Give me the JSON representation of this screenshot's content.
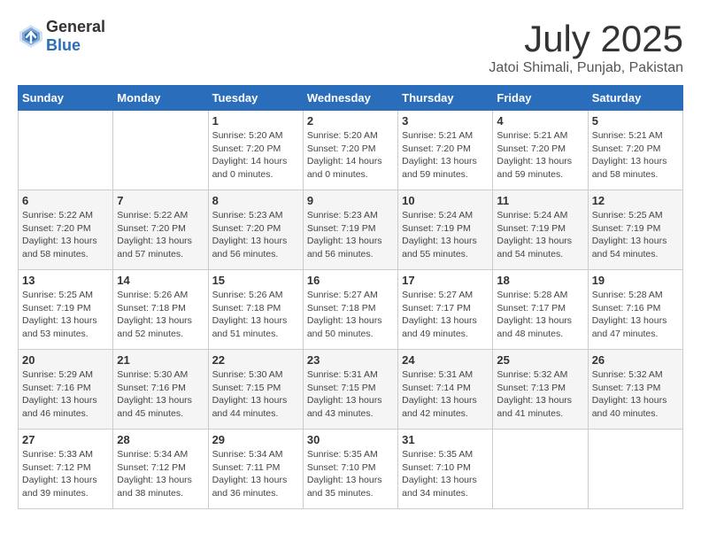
{
  "header": {
    "logo_general": "General",
    "logo_blue": "Blue",
    "title": "July 2025",
    "location": "Jatoi Shimali, Punjab, Pakistan"
  },
  "calendar": {
    "weekdays": [
      "Sunday",
      "Monday",
      "Tuesday",
      "Wednesday",
      "Thursday",
      "Friday",
      "Saturday"
    ],
    "weeks": [
      [
        {
          "day": "",
          "info": ""
        },
        {
          "day": "",
          "info": ""
        },
        {
          "day": "1",
          "info": "Sunrise: 5:20 AM\nSunset: 7:20 PM\nDaylight: 14 hours\nand 0 minutes."
        },
        {
          "day": "2",
          "info": "Sunrise: 5:20 AM\nSunset: 7:20 PM\nDaylight: 14 hours\nand 0 minutes."
        },
        {
          "day": "3",
          "info": "Sunrise: 5:21 AM\nSunset: 7:20 PM\nDaylight: 13 hours\nand 59 minutes."
        },
        {
          "day": "4",
          "info": "Sunrise: 5:21 AM\nSunset: 7:20 PM\nDaylight: 13 hours\nand 59 minutes."
        },
        {
          "day": "5",
          "info": "Sunrise: 5:21 AM\nSunset: 7:20 PM\nDaylight: 13 hours\nand 58 minutes."
        }
      ],
      [
        {
          "day": "6",
          "info": "Sunrise: 5:22 AM\nSunset: 7:20 PM\nDaylight: 13 hours\nand 58 minutes."
        },
        {
          "day": "7",
          "info": "Sunrise: 5:22 AM\nSunset: 7:20 PM\nDaylight: 13 hours\nand 57 minutes."
        },
        {
          "day": "8",
          "info": "Sunrise: 5:23 AM\nSunset: 7:20 PM\nDaylight: 13 hours\nand 56 minutes."
        },
        {
          "day": "9",
          "info": "Sunrise: 5:23 AM\nSunset: 7:19 PM\nDaylight: 13 hours\nand 56 minutes."
        },
        {
          "day": "10",
          "info": "Sunrise: 5:24 AM\nSunset: 7:19 PM\nDaylight: 13 hours\nand 55 minutes."
        },
        {
          "day": "11",
          "info": "Sunrise: 5:24 AM\nSunset: 7:19 PM\nDaylight: 13 hours\nand 54 minutes."
        },
        {
          "day": "12",
          "info": "Sunrise: 5:25 AM\nSunset: 7:19 PM\nDaylight: 13 hours\nand 54 minutes."
        }
      ],
      [
        {
          "day": "13",
          "info": "Sunrise: 5:25 AM\nSunset: 7:19 PM\nDaylight: 13 hours\nand 53 minutes."
        },
        {
          "day": "14",
          "info": "Sunrise: 5:26 AM\nSunset: 7:18 PM\nDaylight: 13 hours\nand 52 minutes."
        },
        {
          "day": "15",
          "info": "Sunrise: 5:26 AM\nSunset: 7:18 PM\nDaylight: 13 hours\nand 51 minutes."
        },
        {
          "day": "16",
          "info": "Sunrise: 5:27 AM\nSunset: 7:18 PM\nDaylight: 13 hours\nand 50 minutes."
        },
        {
          "day": "17",
          "info": "Sunrise: 5:27 AM\nSunset: 7:17 PM\nDaylight: 13 hours\nand 49 minutes."
        },
        {
          "day": "18",
          "info": "Sunrise: 5:28 AM\nSunset: 7:17 PM\nDaylight: 13 hours\nand 48 minutes."
        },
        {
          "day": "19",
          "info": "Sunrise: 5:28 AM\nSunset: 7:16 PM\nDaylight: 13 hours\nand 47 minutes."
        }
      ],
      [
        {
          "day": "20",
          "info": "Sunrise: 5:29 AM\nSunset: 7:16 PM\nDaylight: 13 hours\nand 46 minutes."
        },
        {
          "day": "21",
          "info": "Sunrise: 5:30 AM\nSunset: 7:16 PM\nDaylight: 13 hours\nand 45 minutes."
        },
        {
          "day": "22",
          "info": "Sunrise: 5:30 AM\nSunset: 7:15 PM\nDaylight: 13 hours\nand 44 minutes."
        },
        {
          "day": "23",
          "info": "Sunrise: 5:31 AM\nSunset: 7:15 PM\nDaylight: 13 hours\nand 43 minutes."
        },
        {
          "day": "24",
          "info": "Sunrise: 5:31 AM\nSunset: 7:14 PM\nDaylight: 13 hours\nand 42 minutes."
        },
        {
          "day": "25",
          "info": "Sunrise: 5:32 AM\nSunset: 7:13 PM\nDaylight: 13 hours\nand 41 minutes."
        },
        {
          "day": "26",
          "info": "Sunrise: 5:32 AM\nSunset: 7:13 PM\nDaylight: 13 hours\nand 40 minutes."
        }
      ],
      [
        {
          "day": "27",
          "info": "Sunrise: 5:33 AM\nSunset: 7:12 PM\nDaylight: 13 hours\nand 39 minutes."
        },
        {
          "day": "28",
          "info": "Sunrise: 5:34 AM\nSunset: 7:12 PM\nDaylight: 13 hours\nand 38 minutes."
        },
        {
          "day": "29",
          "info": "Sunrise: 5:34 AM\nSunset: 7:11 PM\nDaylight: 13 hours\nand 36 minutes."
        },
        {
          "day": "30",
          "info": "Sunrise: 5:35 AM\nSunset: 7:10 PM\nDaylight: 13 hours\nand 35 minutes."
        },
        {
          "day": "31",
          "info": "Sunrise: 5:35 AM\nSunset: 7:10 PM\nDaylight: 13 hours\nand 34 minutes."
        },
        {
          "day": "",
          "info": ""
        },
        {
          "day": "",
          "info": ""
        }
      ]
    ]
  }
}
